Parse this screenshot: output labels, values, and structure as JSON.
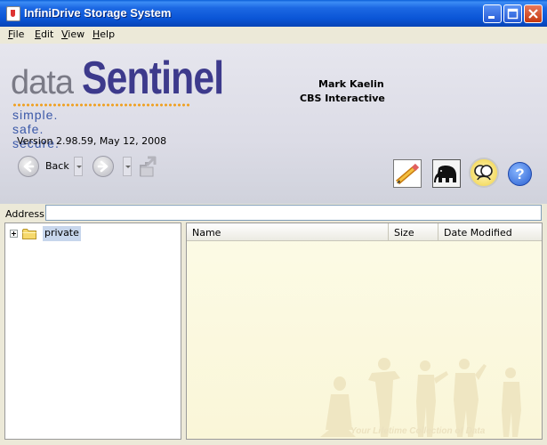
{
  "window": {
    "title": "InfiniDrive Storage System"
  },
  "titlebar_buttons": [
    "minimize-icon",
    "maximize-icon",
    "close-icon"
  ],
  "menu": [
    {
      "label": "File",
      "key": "F",
      "rest": "ile"
    },
    {
      "label": "Edit",
      "key": "E",
      "rest": "dit"
    },
    {
      "label": "View",
      "key": "V",
      "rest": "iew"
    },
    {
      "label": "Help",
      "key": "H",
      "rest": "elp"
    }
  ],
  "header": {
    "logo": {
      "data": "data",
      "sentinel": "Sentinel",
      "tagline": "simple. safe. secure."
    },
    "user_name": "Mark Kaelin",
    "organization": "CBS Interactive",
    "version": "Version 2.98.59,  May 12, 2008"
  },
  "nav": {
    "back_label": "Back",
    "icons": [
      "back-arrow-icon",
      "forward-arrow-icon",
      "up-folder-icon"
    ]
  },
  "tools": [
    "pencil-icon",
    "elephant-icon",
    "people-icon",
    "help-icon"
  ],
  "help_glyph": "?",
  "address": {
    "label": "Address:",
    "value": ""
  },
  "tree": {
    "items": [
      {
        "label": "private",
        "expanded": false
      }
    ]
  },
  "files": {
    "columns": [
      "Name",
      "Size",
      "Date Modified"
    ],
    "rows": [],
    "watermark": "Your Lifetime Collection of Data"
  },
  "colors": {
    "titlebar": "#0a55d6",
    "logo_sentinel": "#3d3a8c",
    "logo_tagline": "#3a58a8",
    "dots": "#f0a020",
    "file_pane_bg": "#faf6d8"
  }
}
